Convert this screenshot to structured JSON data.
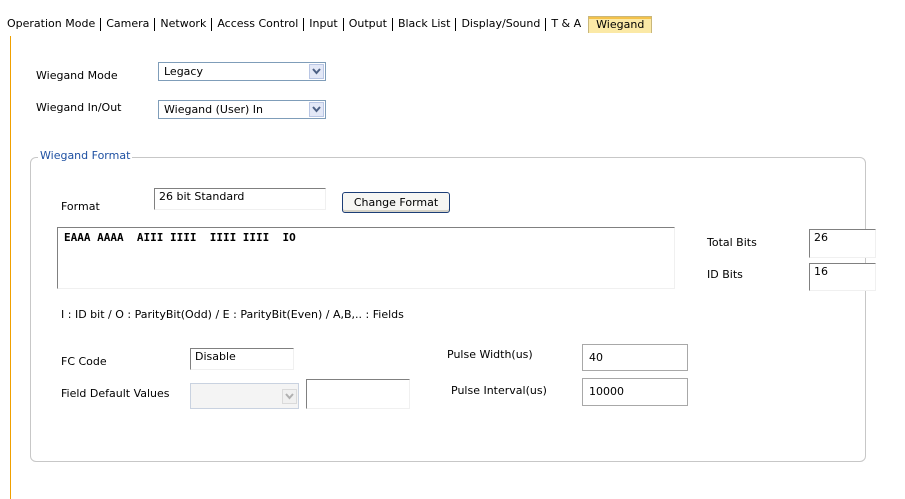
{
  "tabs": [
    {
      "label": "Operation Mode",
      "active": false
    },
    {
      "label": "Camera",
      "active": false
    },
    {
      "label": "Network",
      "active": false
    },
    {
      "label": "Access Control",
      "active": false
    },
    {
      "label": "Input",
      "active": false
    },
    {
      "label": "Output",
      "active": false
    },
    {
      "label": "Black List",
      "active": false
    },
    {
      "label": "Display/Sound",
      "active": false
    },
    {
      "label": "T & A",
      "active": false
    },
    {
      "label": "Wiegand",
      "active": true
    }
  ],
  "wiegand_mode": {
    "label": "Wiegand Mode",
    "value": "Legacy"
  },
  "wiegand_inout": {
    "label": "Wiegand In/Out",
    "value": "Wiegand (User) In"
  },
  "format_group": {
    "legend": "Wiegand Format"
  },
  "format": {
    "label": "Format",
    "value": "26 bit Standard",
    "button": "Change Format"
  },
  "pattern": "EAAA AAAA  AIII IIII  IIII IIII  IO",
  "total_bits": {
    "label": "Total Bits",
    "value": "26"
  },
  "id_bits": {
    "label": "ID Bits",
    "value": "16"
  },
  "legend_text": "I : ID bit  /  O : ParityBit(Odd)  /  E : ParityBit(Even)  /  A,B,.. : Fields",
  "fc_code": {
    "label": "FC Code",
    "value": "Disable"
  },
  "field_default": {
    "label": "Field Default Values",
    "select_value": "",
    "text_value": ""
  },
  "pulse_width": {
    "label": "Pulse Width(us)",
    "value": "40"
  },
  "pulse_interval": {
    "label": "Pulse Interval(us)",
    "value": "10000"
  },
  "colors": {
    "active_tab": "#fbe9a6",
    "legend_text": "#1e50a2",
    "content_border": "#f0a000"
  },
  "icons": {
    "combo_arrow": "chevron-down-icon"
  }
}
